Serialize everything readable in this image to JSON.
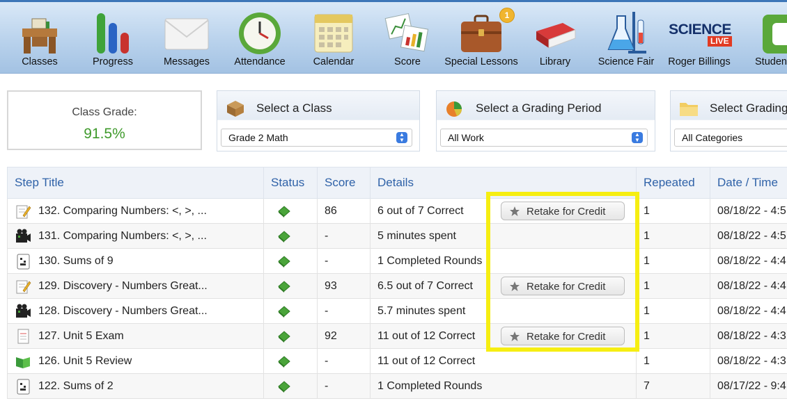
{
  "toolbar": {
    "items": [
      {
        "label": "Classes",
        "icon": "desk-icon"
      },
      {
        "label": "Progress",
        "icon": "bar-chart-icon"
      },
      {
        "label": "Messages",
        "icon": "envelope-icon"
      },
      {
        "label": "Attendance",
        "icon": "clock-icon"
      },
      {
        "label": "Calendar",
        "icon": "calendar-icon"
      },
      {
        "label": "Score",
        "icon": "score-charts-icon"
      },
      {
        "label": "Special Lessons",
        "icon": "briefcase-icon",
        "badge": "1"
      },
      {
        "label": "Library",
        "icon": "book-icon"
      },
      {
        "label": "Science Fair",
        "icon": "flask-icon"
      },
      {
        "label": "Roger Billings",
        "icon": "science-live-logo",
        "logo_text": "SCIENCE",
        "logo_sub": "LIVE"
      },
      {
        "label": "Studen",
        "icon": "student-icon"
      }
    ]
  },
  "class_grade": {
    "label": "Class Grade:",
    "value": "91.5%",
    "color": "#3f9a2c"
  },
  "selectors": [
    {
      "title": "Select a Class",
      "value": "Grade 2 Math",
      "icon": "box-icon"
    },
    {
      "title": "Select a Grading Period",
      "value": "All Work",
      "icon": "pie-chart-icon"
    },
    {
      "title": "Select Grading C",
      "value": "All Categories",
      "icon": "folder-icon"
    }
  ],
  "table": {
    "columns": [
      "Step Title",
      "Status",
      "Score",
      "Details",
      "Repeated",
      "Date / Time"
    ],
    "retake_label": "Retake for Credit",
    "rows": [
      {
        "title": "132. Comparing Numbers: <, >, ...",
        "icon": "quiz-pencil-icon",
        "score": "86",
        "details": "6 out of 7 Correct",
        "retake": true,
        "repeated": "1",
        "date": "08/18/22 - 4:5"
      },
      {
        "title": "131. Comparing Numbers: <, >, ...",
        "icon": "video-icon",
        "score": "-",
        "details": "5 minutes spent",
        "retake": false,
        "repeated": "1",
        "date": "08/18/22 - 4:5"
      },
      {
        "title": "130. Sums of 9",
        "icon": "worksheet-icon",
        "score": "-",
        "details": "1 Completed Rounds",
        "retake": false,
        "repeated": "1",
        "date": "08/18/22 - 4:4"
      },
      {
        "title": "129. Discovery - Numbers Great...",
        "icon": "quiz-pencil-icon",
        "score": "93",
        "details": "6.5 out of 7 Correct",
        "retake": true,
        "repeated": "1",
        "date": "08/18/22 - 4:4"
      },
      {
        "title": "128. Discovery - Numbers Great...",
        "icon": "video-icon",
        "score": "-",
        "details": "5.7 minutes spent",
        "retake": false,
        "repeated": "1",
        "date": "08/18/22 - 4:4"
      },
      {
        "title": "127. Unit 5 Exam",
        "icon": "exam-icon",
        "score": "92",
        "details": "11 out of 12 Correct",
        "retake": true,
        "repeated": "1",
        "date": "08/18/22 - 4:3"
      },
      {
        "title": "126. Unit 5 Review",
        "icon": "review-book-icon",
        "score": "-",
        "details": "11 out of 12 Correct",
        "retake": false,
        "repeated": "1",
        "date": "08/18/22 - 4:3"
      },
      {
        "title": "122. Sums of 2",
        "icon": "worksheet-icon",
        "score": "-",
        "details": "1 Completed Rounds",
        "retake": false,
        "repeated": "7",
        "date": "08/17/22 - 9:4"
      }
    ]
  },
  "colors": {
    "accent": "#2f62a8",
    "highlight": "#f6ee12",
    "status_green": "#4aa43a"
  }
}
